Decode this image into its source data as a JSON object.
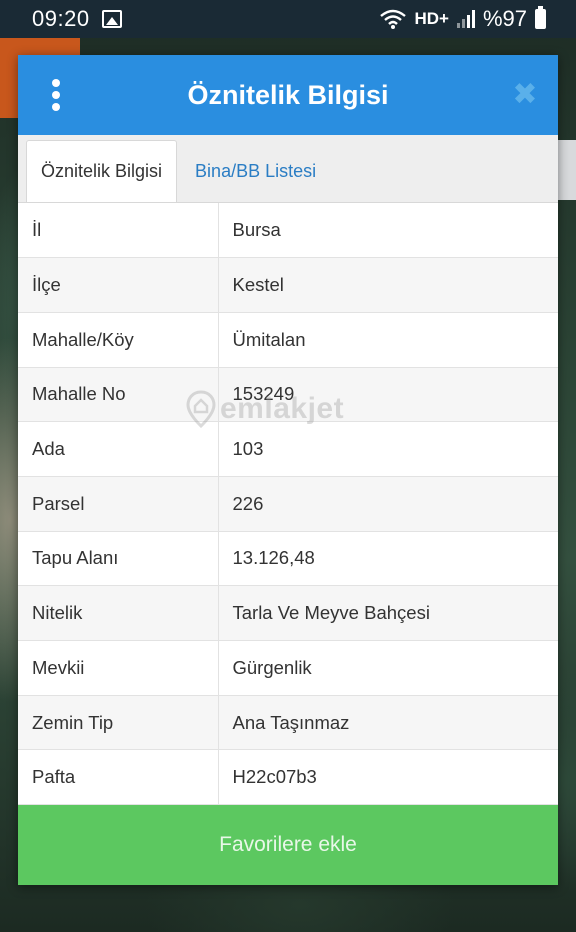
{
  "status_bar": {
    "time": "09:20",
    "network": "HD+",
    "battery": "%97",
    "icons": [
      "image-icon",
      "wifi-icon",
      "signal-icon",
      "battery-icon"
    ]
  },
  "dialog": {
    "title": "Öznitelik Bilgisi",
    "menu_icon": "more-vert-icon",
    "close_icon": "close-icon",
    "close_glyph": "✖",
    "tabs": [
      {
        "label": "Öznitelik Bilgisi",
        "active": true
      },
      {
        "label": "Bina/BB Listesi",
        "active": false
      }
    ],
    "rows": [
      {
        "key": "İl",
        "value": "Bursa"
      },
      {
        "key": "İlçe",
        "value": "Kestel"
      },
      {
        "key": "Mahalle/Köy",
        "value": "Ümitalan"
      },
      {
        "key": "Mahalle No",
        "value": "153249"
      },
      {
        "key": "Ada",
        "value": "103"
      },
      {
        "key": "Parsel",
        "value": "226"
      },
      {
        "key": "Tapu Alanı",
        "value": "13.126,48"
      },
      {
        "key": "Nitelik",
        "value": "Tarla Ve Meyve Bahçesi"
      },
      {
        "key": "Mevkii",
        "value": "Gürgenlik"
      },
      {
        "key": "Zemin Tip",
        "value": "Ana Taşınmaz"
      },
      {
        "key": "Pafta",
        "value": "H22c07b3"
      }
    ],
    "add_favorite_label": "Favorilere ekle"
  },
  "watermark": {
    "text": "emlakjet"
  },
  "colors": {
    "header_blue": "#2a8ee0",
    "tab_link_blue": "#2a7dc4",
    "button_green": "#5cc860",
    "map_orange": "#c8571c"
  }
}
